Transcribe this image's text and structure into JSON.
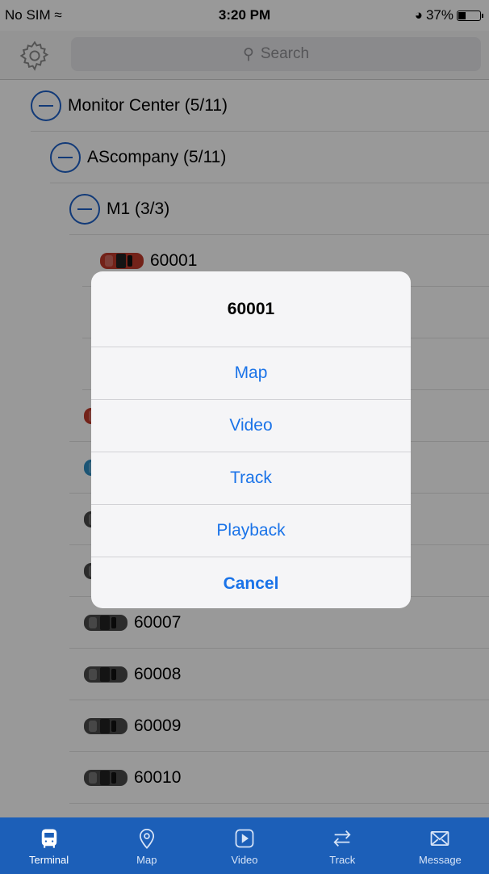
{
  "status_bar": {
    "carrier": "No SIM",
    "time": "3:20 PM",
    "battery": "37%"
  },
  "search": {
    "placeholder": "Search"
  },
  "tree": [
    {
      "label": "Monitor Center (5/11)",
      "type": "group",
      "level": 0
    },
    {
      "label": "AScompany (5/11)",
      "type": "group",
      "level": 1
    },
    {
      "label": "M1 (3/3)",
      "type": "group",
      "level": 2
    },
    {
      "label": "60001",
      "type": "vehicle",
      "color": "red",
      "level": 3
    },
    {
      "label": "",
      "type": "vehicle",
      "color": "red",
      "level": 3
    },
    {
      "label": "",
      "type": "vehicle",
      "color": "red",
      "level": 3
    },
    {
      "label": "",
      "type": "vehicle",
      "color": "red",
      "level": 2
    },
    {
      "label": "",
      "type": "vehicle",
      "color": "blue",
      "level": 2
    },
    {
      "label": "",
      "type": "vehicle",
      "color": "gray",
      "level": 2
    },
    {
      "label": "",
      "type": "vehicle",
      "color": "gray",
      "level": 2
    },
    {
      "label": "60007",
      "type": "vehicle",
      "color": "gray",
      "level": 2
    },
    {
      "label": "60008",
      "type": "vehicle",
      "color": "gray",
      "level": 2
    },
    {
      "label": "60009",
      "type": "vehicle",
      "color": "gray",
      "level": 2
    },
    {
      "label": "60010",
      "type": "vehicle",
      "color": "gray",
      "level": 2
    }
  ],
  "alert": {
    "title": "60001",
    "actions": [
      "Map",
      "Video",
      "Track",
      "Playback"
    ],
    "cancel": "Cancel"
  },
  "tabs": [
    {
      "label": "Terminal",
      "icon": "bus-icon",
      "active": true
    },
    {
      "label": "Map",
      "icon": "map-pin-icon"
    },
    {
      "label": "Video",
      "icon": "video-play-icon"
    },
    {
      "label": "Track",
      "icon": "track-arrows-icon"
    },
    {
      "label": "Message",
      "icon": "envelope-icon"
    }
  ],
  "colors": {
    "accent": "#1a73e8",
    "tabbar": "#1c5fb8",
    "car_red": "#c0392b",
    "car_blue": "#2f8ec4",
    "car_gray": "#4a4a4a"
  }
}
